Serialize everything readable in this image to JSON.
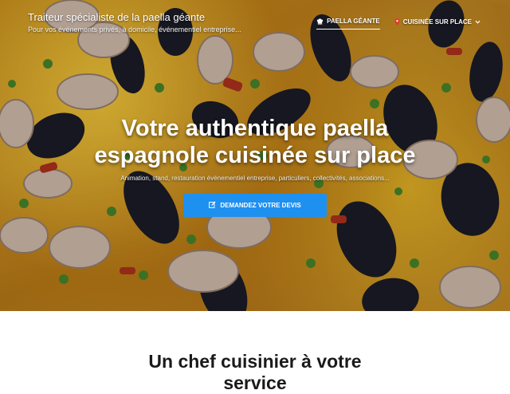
{
  "header": {
    "brand": "Traiteur spécialiste de la paella géante",
    "tagline": "Pour vos événements privés, à domicile, événementiel entreprise..."
  },
  "nav": {
    "items": [
      {
        "label": "PAELLA GÉANTE",
        "icon": "chef-hat-icon",
        "active": true
      },
      {
        "label": "CUISINÉE SUR PLACE",
        "icon": "location-pin-icon",
        "dropdown": true
      }
    ]
  },
  "hero": {
    "headline_line1": "Votre authentique paella",
    "headline_line2": "espagnole cuisinée sur place",
    "subtitle": "Animation, stand, restauration événementiel entreprise, particuliers, collectivités, associations...",
    "cta_label": "DEMANDEZ VOTRE DEVIS",
    "cta_color": "#1e90f0"
  },
  "section": {
    "title_line1": "Un chef cuisinier à votre",
    "title_line2": "service"
  }
}
